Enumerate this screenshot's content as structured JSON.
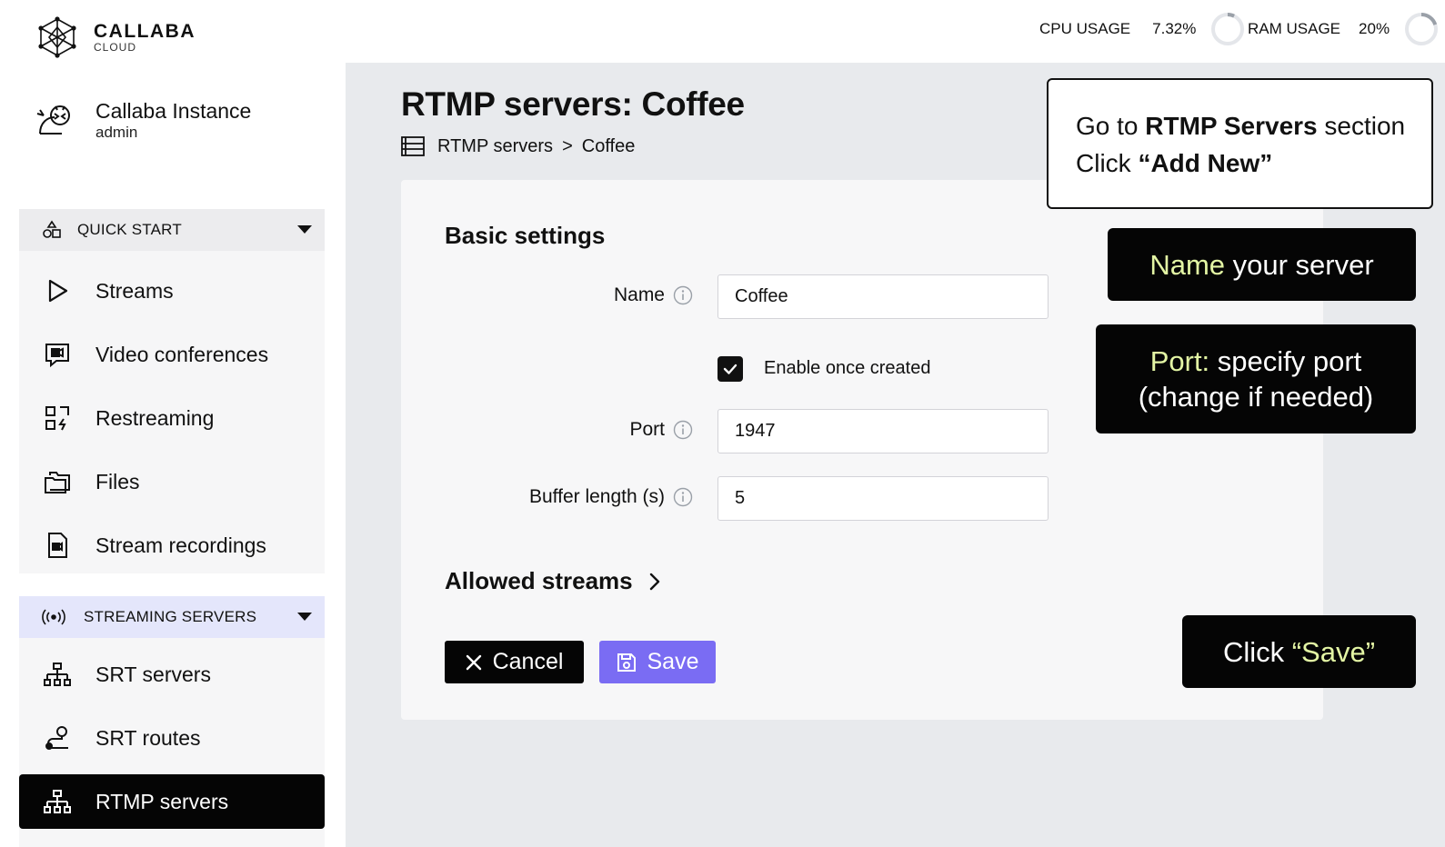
{
  "brand": {
    "name": "CALLABA",
    "sub": "CLOUD"
  },
  "instance": {
    "name": "Callaba Instance",
    "user": "admin"
  },
  "sidebar": {
    "quick_start": {
      "label": "QUICK START",
      "items": [
        {
          "label": "Streams",
          "icon": "play-icon"
        },
        {
          "label": "Video conferences",
          "icon": "video-chat-icon"
        },
        {
          "label": "Restreaming",
          "icon": "restream-icon"
        },
        {
          "label": "Files",
          "icon": "folder-icon"
        },
        {
          "label": "Stream recordings",
          "icon": "recording-file-icon"
        }
      ]
    },
    "streaming_servers": {
      "label": "STREAMING SERVERS",
      "items": [
        {
          "label": "SRT servers",
          "icon": "network-icon"
        },
        {
          "label": "SRT routes",
          "icon": "route-icon"
        },
        {
          "label": "RTMP servers",
          "icon": "network-icon",
          "active": true
        }
      ]
    }
  },
  "topbar": {
    "cpu_label": "CPU USAGE",
    "cpu_value": "7.32%",
    "cpu_fraction": 0.0732,
    "ram_label": "RAM USAGE",
    "ram_value": "20%",
    "ram_fraction": 0.2
  },
  "page": {
    "title": "RTMP servers: Coffee",
    "breadcrumb": [
      "RTMP servers",
      ">",
      "Coffee"
    ]
  },
  "form": {
    "section_title": "Basic settings",
    "name_label": "Name",
    "name_value": "Coffee",
    "enable_label": "Enable once created",
    "enable_checked": true,
    "port_label": "Port",
    "port_value": "1947",
    "buffer_label": "Buffer length (s)",
    "buffer_value": "5",
    "allowed_label": "Allowed streams",
    "cancel_label": "Cancel",
    "save_label": "Save"
  },
  "callouts": {
    "goto": {
      "line1_a": "Go to ",
      "line1_b": "RTMP Servers",
      "line1_c": " section",
      "line2_a": "Click ",
      "line2_b": "“Add New”"
    },
    "name": {
      "hl": "Name",
      "rest": " your server"
    },
    "port": {
      "hl": "Port:",
      "rest": " specify port",
      "line2": "(change if needed)"
    },
    "save": {
      "a": "Click ",
      "hl": "“Save”"
    }
  },
  "colors": {
    "accent": "#7a6cf3",
    "highlight": "#e3f5a4",
    "active_bg": "#050505"
  }
}
